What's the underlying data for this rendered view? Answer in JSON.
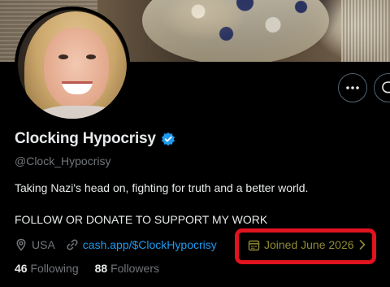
{
  "profile": {
    "display_name": "Clocking Hypocrisy",
    "handle": "@Clock_Hypocrisy",
    "bio_line1": "Taking Nazi's head on, fighting for truth and a better world.",
    "bio_line2": "FOLLOW OR DONATE TO SUPPORT MY WORK",
    "location": "USA",
    "website": "cash.app/$ClockHypocrisy",
    "joined": "Joined June 2026",
    "following_count": "46",
    "following_label": "Following",
    "followers_count": "88",
    "followers_label": "Followers",
    "verified": true
  },
  "icons": {
    "more": "more-dots-icon",
    "message": "message-icon",
    "verified": "verified-badge-icon",
    "location": "location-pin-icon",
    "link": "link-icon",
    "calendar": "calendar-icon",
    "chevron": "chevron-right-icon"
  },
  "colors": {
    "accent": "#1d9bf0",
    "muted_text": "#71767b",
    "joined_text": "#8f8a32",
    "highlight_annotation": "#e0131e"
  }
}
